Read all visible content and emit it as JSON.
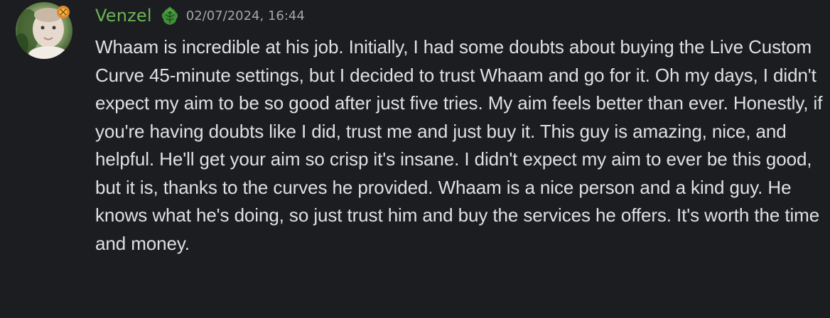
{
  "message": {
    "author": "Venzel",
    "timestamp": "02/07/2024, 16:44",
    "text": "Whaam is incredible at his job. Initially, I had some doubts about buying the Live Custom Curve 45-minute settings, but I decided to trust Whaam and go for it. Oh my days, I didn't expect my aim to be so good after just five tries. My aim feels better than ever. Honestly, if you're having doubts like I did, trust me and just buy it. This guy is amazing, nice, and helpful. He'll get your aim so crisp it's insane. I didn't expect my aim to ever be this good, but it is, thanks to the curves he provided. Whaam is a nice person and a kind guy. He knows what he's doing, so just trust him and buy the services he offers. It's worth the time and money."
  },
  "colors": {
    "background": "#1b1d20",
    "username": "#6cb356",
    "timestamp": "#a3a6ab",
    "text": "#dfe0e2"
  },
  "icons": {
    "avatar": "user-avatar",
    "avatar_badge": "avatar-decoration-icon",
    "role": "green-leaf-role-icon"
  }
}
